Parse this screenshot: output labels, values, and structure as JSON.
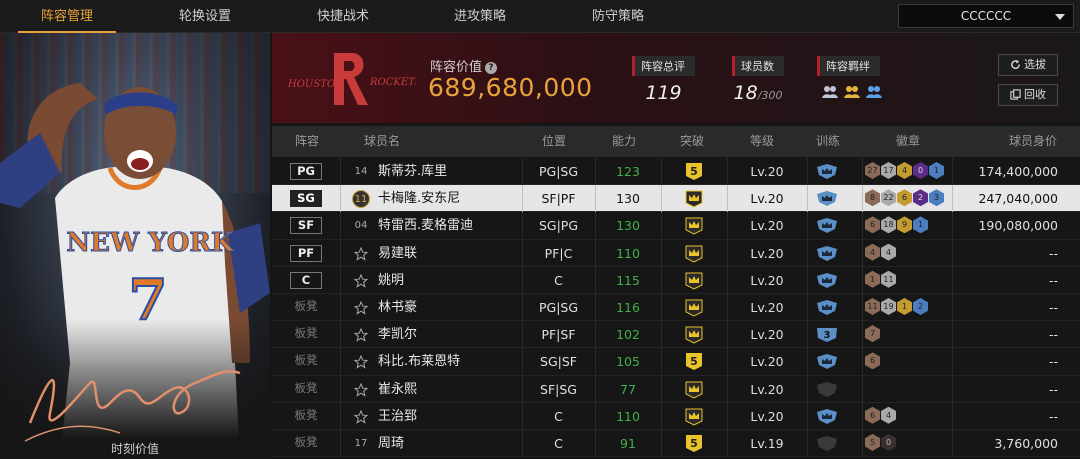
{
  "nav": {
    "tabs": [
      {
        "label": "阵容管理",
        "active": true
      },
      {
        "label": "轮换设置",
        "active": false
      },
      {
        "label": "快捷战术",
        "active": false
      },
      {
        "label": "进攻策略",
        "active": false
      },
      {
        "label": "防守策略",
        "active": false
      }
    ],
    "team_select": "CCCCCC"
  },
  "portrait": {
    "jersey_team": "NEW YORK",
    "jersey_number": "7",
    "caption": "时刻价值"
  },
  "team": {
    "logo_text_left": "HOUSTON",
    "logo_text_right": "ROCKETS",
    "value_label": "阵容价值",
    "value": "689,680,000",
    "rating_label": "阵容总评",
    "rating": "119",
    "players_label": "球员数",
    "players_count": "18",
    "players_max": "/300",
    "chem_label": "阵容羁绊",
    "btn_select": "选拔",
    "btn_recycle": "回收"
  },
  "table": {
    "headers": [
      "阵容",
      "球员名",
      "位置",
      "能力",
      "突破",
      "等级",
      "训练",
      "徽章",
      "球员身价"
    ],
    "rows": [
      {
        "slot": "PG",
        "bench": false,
        "num": "14",
        "name": "斯蒂芬.库里",
        "pos": "PG|SG",
        "ability": "123",
        "green": true,
        "breakthrough": "5",
        "level": "Lv.20",
        "training": "",
        "badges": [
          [
            "27",
            "b-bronze"
          ],
          [
            "17",
            "b-silver"
          ],
          [
            "4",
            "b-gold"
          ],
          [
            "0",
            "b-purple"
          ],
          [
            "1",
            "b-blue"
          ]
        ],
        "salary": "174,400,000"
      },
      {
        "slot": "SG",
        "bench": false,
        "num": "11",
        "name": "卡梅隆.安东尼",
        "pos": "SF|PF",
        "ability": "130",
        "green": false,
        "breakthrough": "",
        "level": "Lv.20",
        "training": "",
        "badges": [
          [
            "8",
            "b-bronze"
          ],
          [
            "22",
            "b-silver"
          ],
          [
            "6",
            "b-gold"
          ],
          [
            "2",
            "b-purple"
          ],
          [
            "3",
            "b-blue"
          ]
        ],
        "salary": "247,040,000",
        "selected": true
      },
      {
        "slot": "SF",
        "bench": false,
        "num": "04",
        "name": "特雷西.麦格雷迪",
        "pos": "SG|PG",
        "ability": "130",
        "green": true,
        "breakthrough": "",
        "level": "Lv.20",
        "training": "",
        "badges": [
          [
            "6",
            "b-bronze"
          ],
          [
            "18",
            "b-silver"
          ],
          [
            "9",
            "b-gold"
          ],
          [
            "1",
            "b-blue"
          ]
        ],
        "salary": "190,080,000"
      },
      {
        "slot": "PF",
        "bench": false,
        "num": "",
        "name": "易建联",
        "pos": "PF|C",
        "ability": "110",
        "green": true,
        "breakthrough": "",
        "level": "Lv.20",
        "training": "",
        "badges": [
          [
            "4",
            "b-bronze"
          ],
          [
            "4",
            "b-silver"
          ]
        ],
        "salary": "--"
      },
      {
        "slot": "C",
        "bench": false,
        "num": "",
        "name": "姚明",
        "pos": "C",
        "ability": "115",
        "green": true,
        "breakthrough": "",
        "level": "Lv.20",
        "training": "",
        "badges": [
          [
            "1",
            "b-bronze"
          ],
          [
            "11",
            "b-silver"
          ]
        ],
        "salary": "--"
      },
      {
        "slot": "板凳",
        "bench": true,
        "num": "",
        "name": "林书豪",
        "pos": "PG|SG",
        "ability": "116",
        "green": true,
        "breakthrough": "",
        "level": "Lv.20",
        "training": "",
        "badges": [
          [
            "11",
            "b-bronze"
          ],
          [
            "19",
            "b-silver"
          ],
          [
            "1",
            "b-gold"
          ],
          [
            "2",
            "b-blue"
          ]
        ],
        "salary": "--"
      },
      {
        "slot": "板凳",
        "bench": true,
        "num": "",
        "name": "李凯尔",
        "pos": "PF|SF",
        "ability": "102",
        "green": true,
        "breakthrough": "",
        "level": "Lv.20",
        "training": "3",
        "badges": [
          [
            "7",
            "b-bronze"
          ]
        ],
        "salary": "--"
      },
      {
        "slot": "板凳",
        "bench": true,
        "num": "",
        "name": "科比.布莱恩特",
        "pos": "SG|SF",
        "ability": "105",
        "green": true,
        "breakthrough": "5",
        "level": "Lv.20",
        "training": "",
        "badges": [
          [
            "6",
            "b-bronze"
          ]
        ],
        "salary": "--"
      },
      {
        "slot": "板凳",
        "bench": true,
        "num": "",
        "name": "崔永熙",
        "pos": "SF|SG",
        "ability": "77",
        "green": true,
        "breakthrough": "",
        "level": "Lv.20",
        "training": "dark",
        "badges": [],
        "salary": "--"
      },
      {
        "slot": "板凳",
        "bench": true,
        "num": "",
        "name": "王治郅",
        "pos": "C",
        "ability": "110",
        "green": true,
        "breakthrough": "",
        "level": "Lv.20",
        "training": "",
        "badges": [
          [
            "6",
            "b-bronze"
          ],
          [
            "4",
            "b-silver"
          ]
        ],
        "salary": "--"
      },
      {
        "slot": "板凳",
        "bench": true,
        "num": "17",
        "name": "周琦",
        "pos": "C",
        "ability": "91",
        "green": true,
        "breakthrough": "5",
        "level": "Lv.19",
        "training": "dark",
        "badges": [
          [
            "5",
            "b-bronze"
          ],
          [
            "0",
            "b-dark"
          ]
        ],
        "salary": "3,760,000"
      }
    ]
  },
  "colors": {
    "accent": "#e8a43a",
    "green": "#3fb04a",
    "brand_red": "#b51f2b"
  }
}
